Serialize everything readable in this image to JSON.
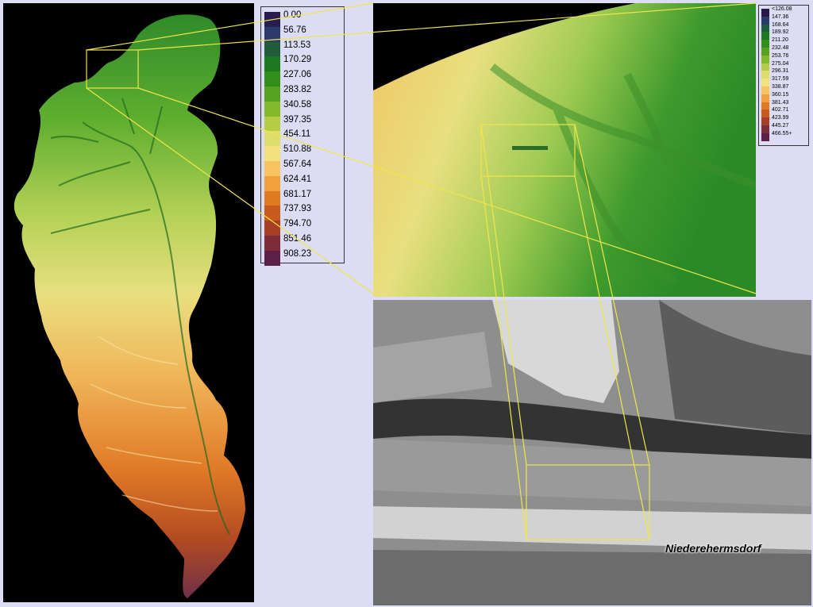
{
  "main_legend": {
    "labels": [
      "0.00",
      "56.76",
      "113.53",
      "170.29",
      "227.06",
      "283.82",
      "340.58",
      "397.35",
      "454.11",
      "510.88",
      "567.64",
      "624.41",
      "681.17",
      "737.93",
      "794.70",
      "851.46",
      "908.23"
    ],
    "colors": [
      "#281c50",
      "#2a3a6a",
      "#1e5e3a",
      "#1b7a20",
      "#2f8f1a",
      "#55a21f",
      "#84b92c",
      "#b5cd45",
      "#dedc6a",
      "#f2e27e",
      "#f5c460",
      "#f0a03c",
      "#e07a22",
      "#c85a1e",
      "#a83e26",
      "#7e2c3a",
      "#5a2048"
    ]
  },
  "small_legend": {
    "labels": [
      "<126.08",
      "147.36",
      "168.64",
      "189.92",
      "211.20",
      "232.48",
      "253.76",
      "275.04",
      "296.31",
      "317.59",
      "338.87",
      "360.15",
      "381.43",
      "402.71",
      "423.99",
      "445.27",
      "466.55+"
    ],
    "colors": [
      "#2a1a4a",
      "#2a3a6a",
      "#1e5e3a",
      "#1b7a20",
      "#2f8f1a",
      "#55a21f",
      "#84b92c",
      "#b5cd45",
      "#dedc6a",
      "#f2e27e",
      "#f5c460",
      "#f0a03c",
      "#e07a22",
      "#c85a1e",
      "#a83e26",
      "#7e2c3a",
      "#5a2048"
    ]
  },
  "place_name": "Niederehermsdorf"
}
